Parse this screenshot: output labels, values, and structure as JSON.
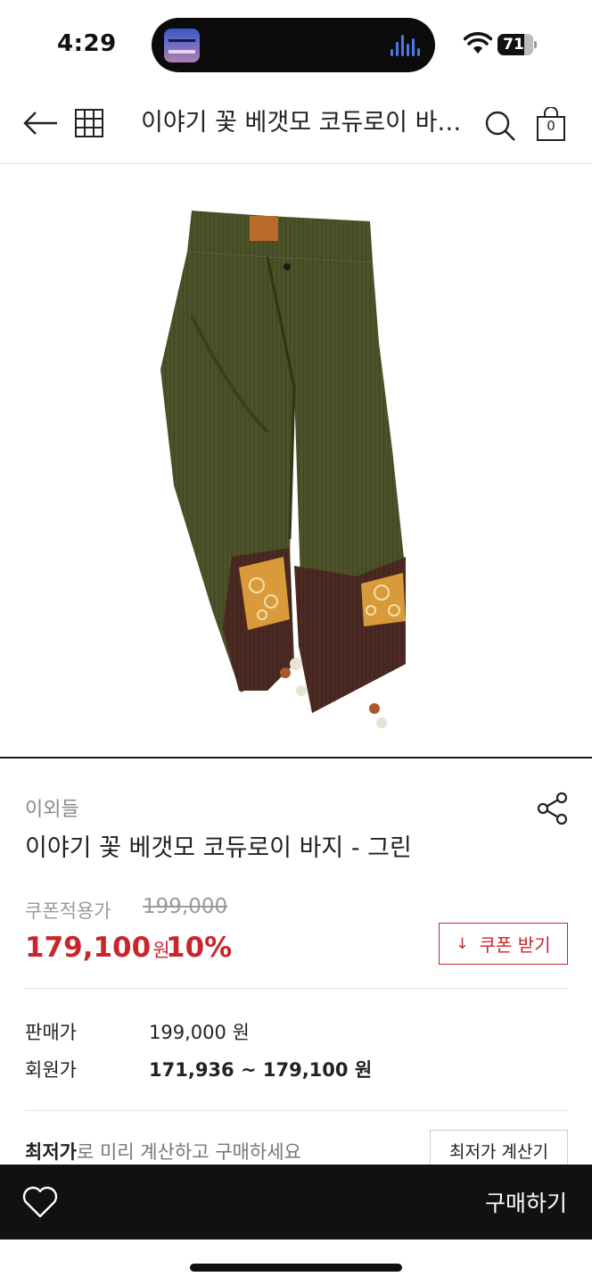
{
  "status_bar": {
    "time": "4:29",
    "battery": "71"
  },
  "header": {
    "title": "이야기 꽃 베갯모 코듀로이 바지 - 그린",
    "cart_count": "0"
  },
  "product": {
    "brand": "이외들",
    "name": "이야기 꽃 베갯모 코듀로이 바지 - 그린",
    "coupon_label": "쿠폰적용가",
    "original_price": "199,000",
    "sale_price": "179,100",
    "currency": "원",
    "discount": "10%",
    "coupon_button": "쿠폰 받기",
    "coupon_button_icon": "↓",
    "rows": [
      {
        "label": "판매가",
        "value": "199,000 원"
      },
      {
        "label": "회원가",
        "value": "171,936 ~ 179,100 원"
      }
    ],
    "lowest": {
      "bold": "최저가",
      "rest": "로 미리 계산하고 구매하세요",
      "button": "최저가 계산기"
    }
  },
  "bottom_bar": {
    "buy_label": "구매하기"
  },
  "colors": {
    "accent": "#c8262a",
    "bottom_bar": "#111111",
    "pants": "#4b5128",
    "patch": "#d99a3c",
    "cuff": "#4a2a22"
  }
}
